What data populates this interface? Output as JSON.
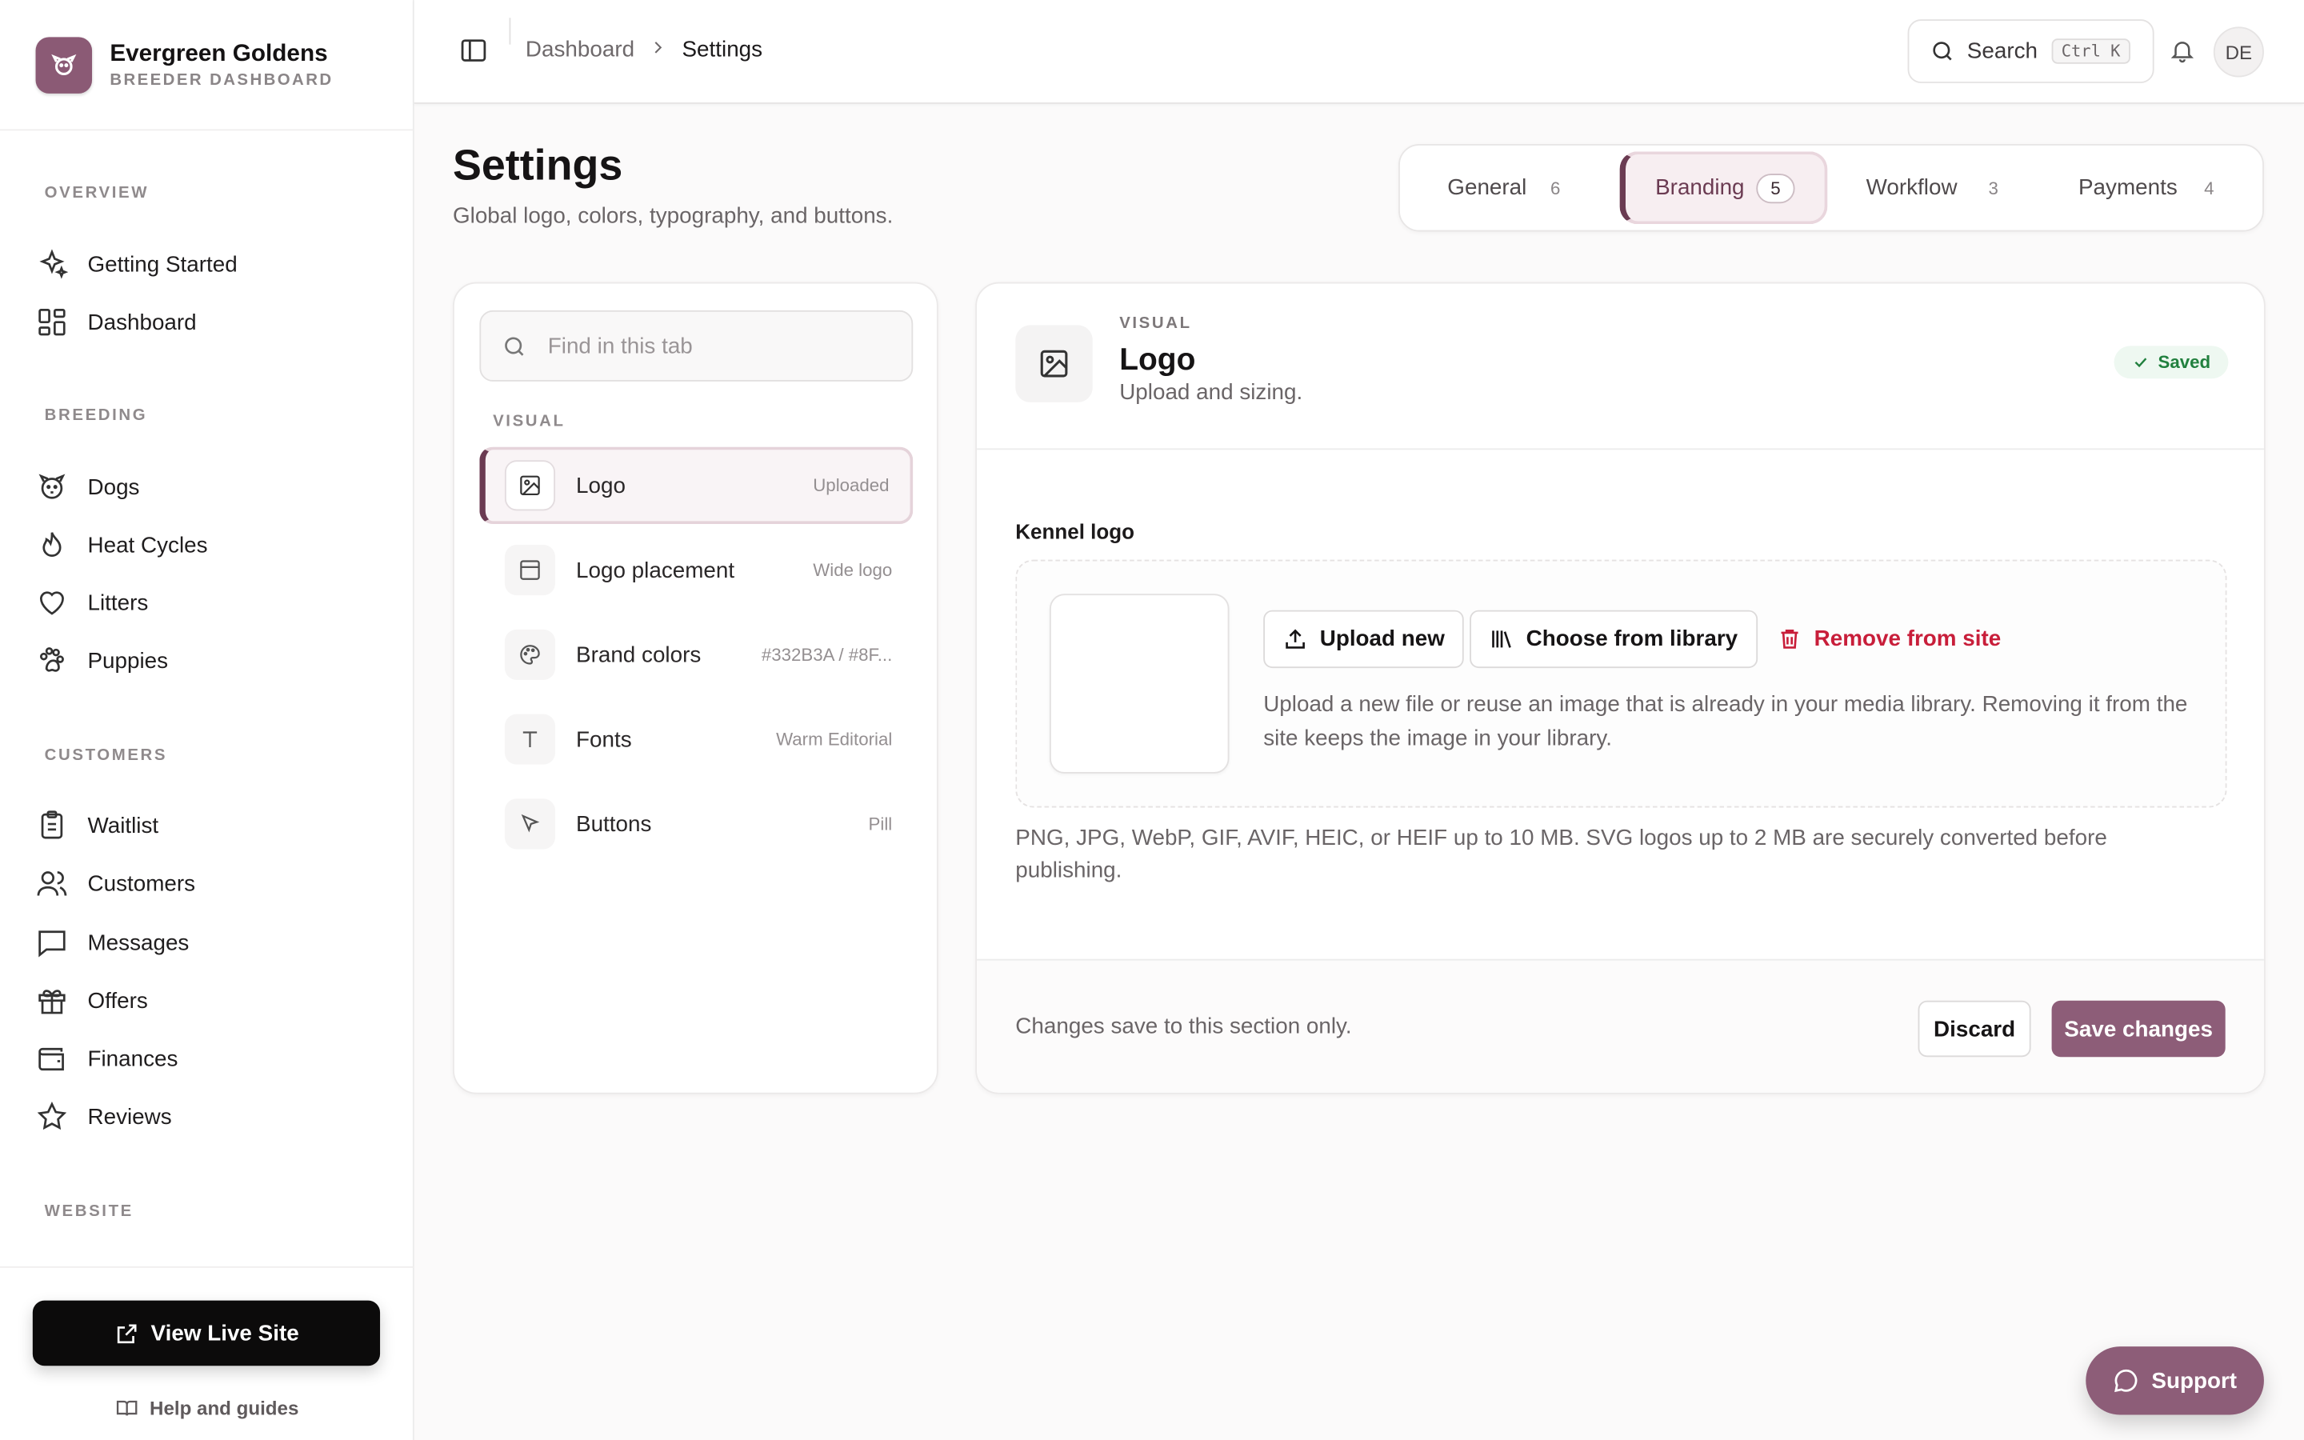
{
  "brand": {
    "title": "Evergreen Goldens",
    "subtitle": "BREEDER DASHBOARD"
  },
  "sidebar": {
    "sections": [
      {
        "label": "OVERVIEW"
      },
      {
        "label": "BREEDING"
      },
      {
        "label": "CUSTOMERS"
      },
      {
        "label": "WEBSITE"
      }
    ],
    "items": [
      {
        "label": "Getting Started",
        "icon": "sparkles-icon"
      },
      {
        "label": "Dashboard",
        "icon": "grid-icon"
      },
      {
        "label": "Dogs",
        "icon": "dog-icon"
      },
      {
        "label": "Heat Cycles",
        "icon": "flame-icon"
      },
      {
        "label": "Litters",
        "icon": "heart-icon"
      },
      {
        "label": "Puppies",
        "icon": "paw-icon"
      },
      {
        "label": "Waitlist",
        "icon": "clipboard-icon"
      },
      {
        "label": "Customers",
        "icon": "users-icon"
      },
      {
        "label": "Messages",
        "icon": "message-icon"
      },
      {
        "label": "Offers",
        "icon": "gift-icon"
      },
      {
        "label": "Finances",
        "icon": "wallet-icon"
      },
      {
        "label": "Reviews",
        "icon": "star-icon"
      }
    ],
    "live_site": "View Live Site",
    "help": "Help and guides"
  },
  "topbar": {
    "breadcrumbs": [
      "Dashboard",
      "Settings"
    ],
    "search_label": "Search",
    "search_kbd": "Ctrl K",
    "avatar": "DE"
  },
  "page": {
    "title": "Settings",
    "subtitle": "Global logo, colors, typography, and buttons."
  },
  "tabs": [
    {
      "label": "General",
      "count": "6"
    },
    {
      "label": "Branding",
      "count": "5",
      "active": true
    },
    {
      "label": "Workflow",
      "count": "3"
    },
    {
      "label": "Payments",
      "count": "4"
    }
  ],
  "list": {
    "find_placeholder": "Find in this tab",
    "section": "VISUAL",
    "items": [
      {
        "label": "Logo",
        "meta": "Uploaded",
        "icon": "image-icon",
        "active": true
      },
      {
        "label": "Logo placement",
        "meta": "Wide logo",
        "icon": "layout-icon"
      },
      {
        "label": "Brand colors",
        "meta": "#332B3A / #8F...",
        "icon": "palette-icon"
      },
      {
        "label": "Fonts",
        "meta": "Warm Editorial",
        "icon": "type-icon"
      },
      {
        "label": "Buttons",
        "meta": "Pill",
        "icon": "pointer-icon"
      }
    ]
  },
  "detail": {
    "eyebrow": "VISUAL",
    "title": "Logo",
    "subtitle": "Upload and sizing.",
    "status": "Saved",
    "field_label": "Kennel logo",
    "upload_btn": "Upload new",
    "library_btn": "Choose from library",
    "remove_btn": "Remove from site",
    "drop_help": "Upload a new file or reuse an image that is already in your media library. Removing it from the site keeps the image in your library.",
    "formats": "PNG, JPG, WebP, GIF, AVIF, HEIC, or HEIF up to 10 MB. SVG logos up to 2 MB are securely converted before publishing.",
    "footer_note": "Changes save to this section only.",
    "discard": "Discard",
    "save": "Save changes"
  },
  "support": "Support",
  "colors": {
    "accent": "#8D5D78",
    "accent_dark": "#6B3B52",
    "danger": "#C81E3A",
    "success": "#21803E"
  }
}
